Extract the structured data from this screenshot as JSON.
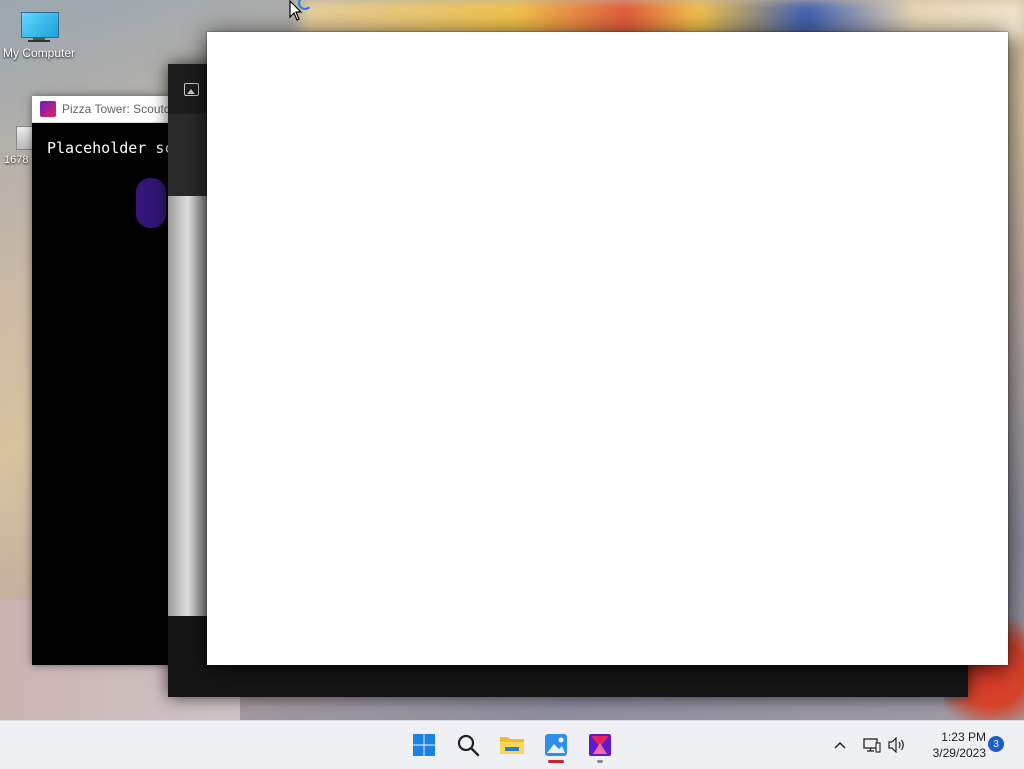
{
  "desktop": {
    "icons": [
      {
        "label": "My Computer"
      },
      {
        "label": "1678"
      }
    ]
  },
  "pizza_tower_window": {
    "title": "Pizza Tower: Scoutdi",
    "body_text": "Placeholder sc"
  },
  "taskbar": {
    "apps": [
      "start-button",
      "search-button",
      "file-explorer",
      "photos-app",
      "pizza-tower-app"
    ],
    "clock": {
      "time": "1:23 PM",
      "date": "3/29/2023"
    },
    "notification_count": "3",
    "colors": {
      "running_indicator_red": "#c4262e",
      "running_indicator_gray": "#8a8a8a",
      "accent": "#1a5fc9"
    }
  }
}
